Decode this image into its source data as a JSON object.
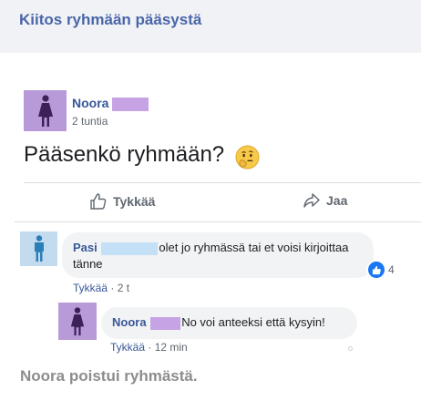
{
  "banner": {
    "title": "Kiitos ryhmään pääsystä"
  },
  "post": {
    "author": "Noora",
    "time": "2 tuntia",
    "text": "Pääsenkö ryhmään?",
    "emoji": "thinking-face-icon",
    "actions": {
      "like": "Tykkää",
      "share": "Jaa"
    }
  },
  "comments": [
    {
      "author": "Pasi",
      "text": "olet jo ryhmässä tai et voisi kirjoittaa tänne",
      "like_label": "Tykkää",
      "time": "2 t",
      "reaction_count": "4"
    }
  ],
  "reply": {
    "author": "Noora",
    "text": "No voi anteeksi että kysyin!",
    "like_label": "Tykkää",
    "time": "12 min"
  },
  "notice": "Noora poistui ryhmästä.",
  "colors": {
    "link": "#365899",
    "banner_text": "#4a66a8",
    "avatar_female": "#b89ad8",
    "avatar_male": "#c3dbee",
    "like_blue": "#1877f2"
  }
}
